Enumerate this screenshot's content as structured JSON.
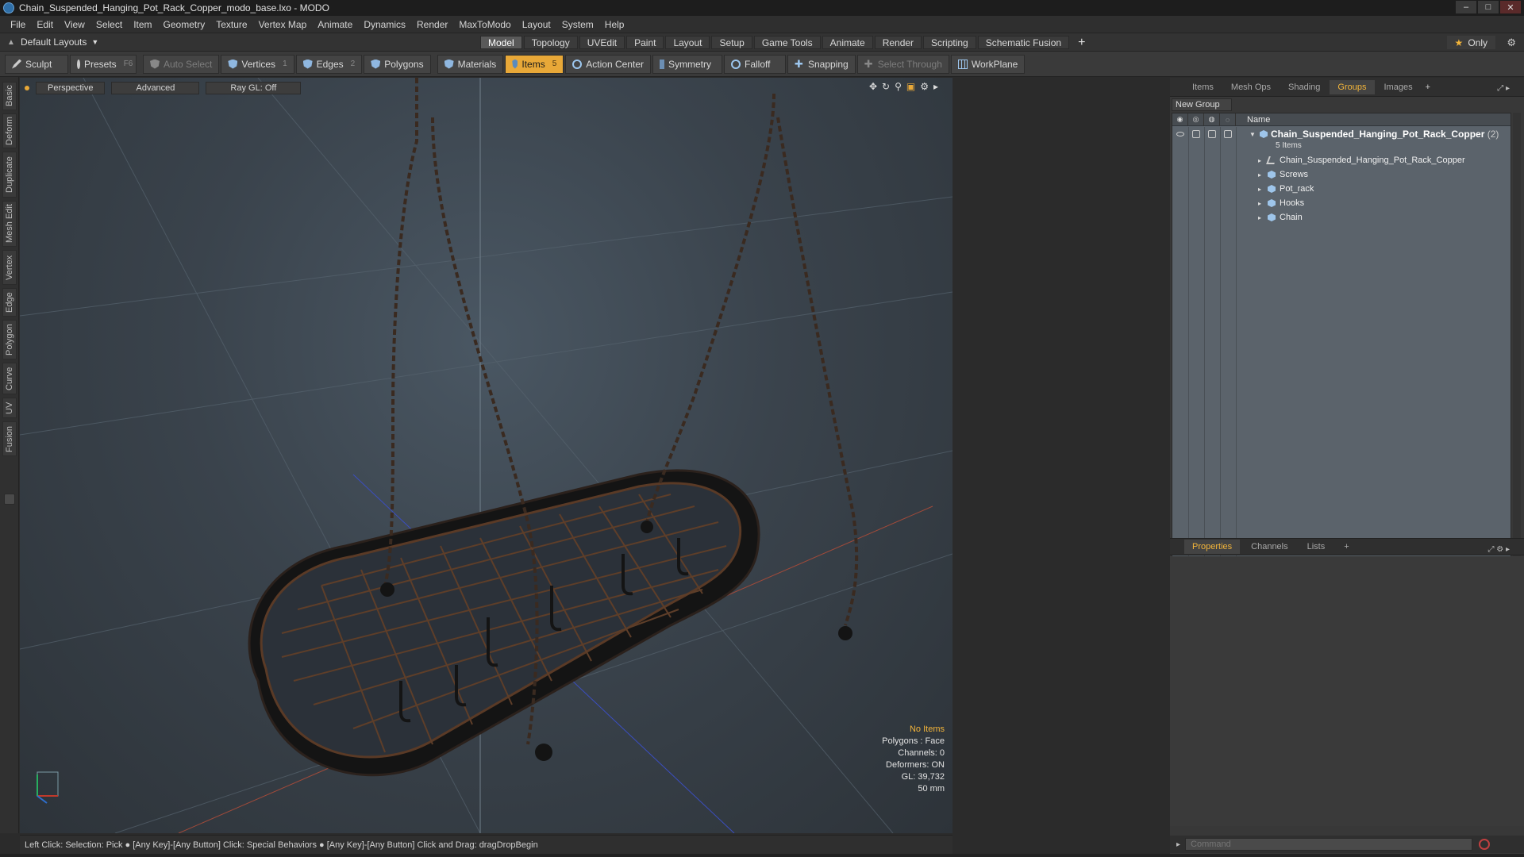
{
  "window": {
    "title": "Chain_Suspended_Hanging_Pot_Rack_Copper_modo_base.lxo - MODO"
  },
  "menu": [
    "File",
    "Edit",
    "View",
    "Select",
    "Item",
    "Geometry",
    "Texture",
    "Vertex Map",
    "Animate",
    "Dynamics",
    "Render",
    "MaxToModo",
    "Layout",
    "System",
    "Help"
  ],
  "layout_bar": {
    "layout_select": "Default Layouts",
    "tabs": [
      "Model",
      "Topology",
      "UVEdit",
      "Paint",
      "Layout",
      "Setup",
      "Game Tools",
      "Animate",
      "Render",
      "Scripting",
      "Schematic Fusion"
    ],
    "active_tab": "Model",
    "add_tab": "+",
    "only_label": "Only"
  },
  "toolbar": {
    "sculpt": "Sculpt",
    "presets": "Presets",
    "presets_key": "F6",
    "auto_select": "Auto Select",
    "vertices": "Vertices",
    "vertices_key": "1",
    "edges": "Edges",
    "edges_key": "2",
    "polygons": "Polygons",
    "materials": "Materials",
    "items": "Items",
    "items_key": "5",
    "action_center": "Action Center",
    "symmetry": "Symmetry",
    "falloff": "Falloff",
    "snapping": "Snapping",
    "select_through": "Select Through",
    "workplane": "WorkPlane"
  },
  "left_tabs": [
    "Basic",
    "Deform",
    "Duplicate",
    "Mesh Edit",
    "Vertex",
    "Edge",
    "Polygon",
    "Curve",
    "UV",
    "Fusion"
  ],
  "viewport": {
    "view": "Perspective",
    "shading": "Advanced",
    "raygl": "Ray GL: Off",
    "info": {
      "selection": "No Items",
      "polygons": "Polygons : Face",
      "channels": "Channels: 0",
      "deformers": "Deformers: ON",
      "gl": "GL: 39,732",
      "scale": "50 mm"
    }
  },
  "status_bar": "Left Click: Selection: Pick ●  [Any Key]-[Any Button] Click: Special Behaviors ●  [Any Key]-[Any Button] Click and Drag: dragDropBegin",
  "right_panel": {
    "tabs": [
      "Items",
      "Mesh Ops",
      "Shading",
      "Groups",
      "Images"
    ],
    "active_tab": "Groups",
    "new_group": "New Group",
    "column_name": "Name",
    "group": {
      "name": "Chain_Suspended_Hanging_Pot_Rack_Copper",
      "count": "(2)",
      "subtitle": "5 Items"
    },
    "children": [
      {
        "name": "Chain_Suspended_Hanging_Pot_Rack_Copper",
        "kind": "locator"
      },
      {
        "name": "Screws",
        "kind": "mesh"
      },
      {
        "name": "Pot_rack",
        "kind": "mesh"
      },
      {
        "name": "Hooks",
        "kind": "mesh"
      },
      {
        "name": "Chain",
        "kind": "mesh"
      }
    ],
    "lower_tabs": [
      "Properties",
      "Channels",
      "Lists"
    ],
    "lower_active": "Properties",
    "command_placeholder": "Command"
  },
  "colors": {
    "accent": "#e8a838",
    "viewport_bg": "#3a434c",
    "outliner_bg": "#5b636b"
  }
}
